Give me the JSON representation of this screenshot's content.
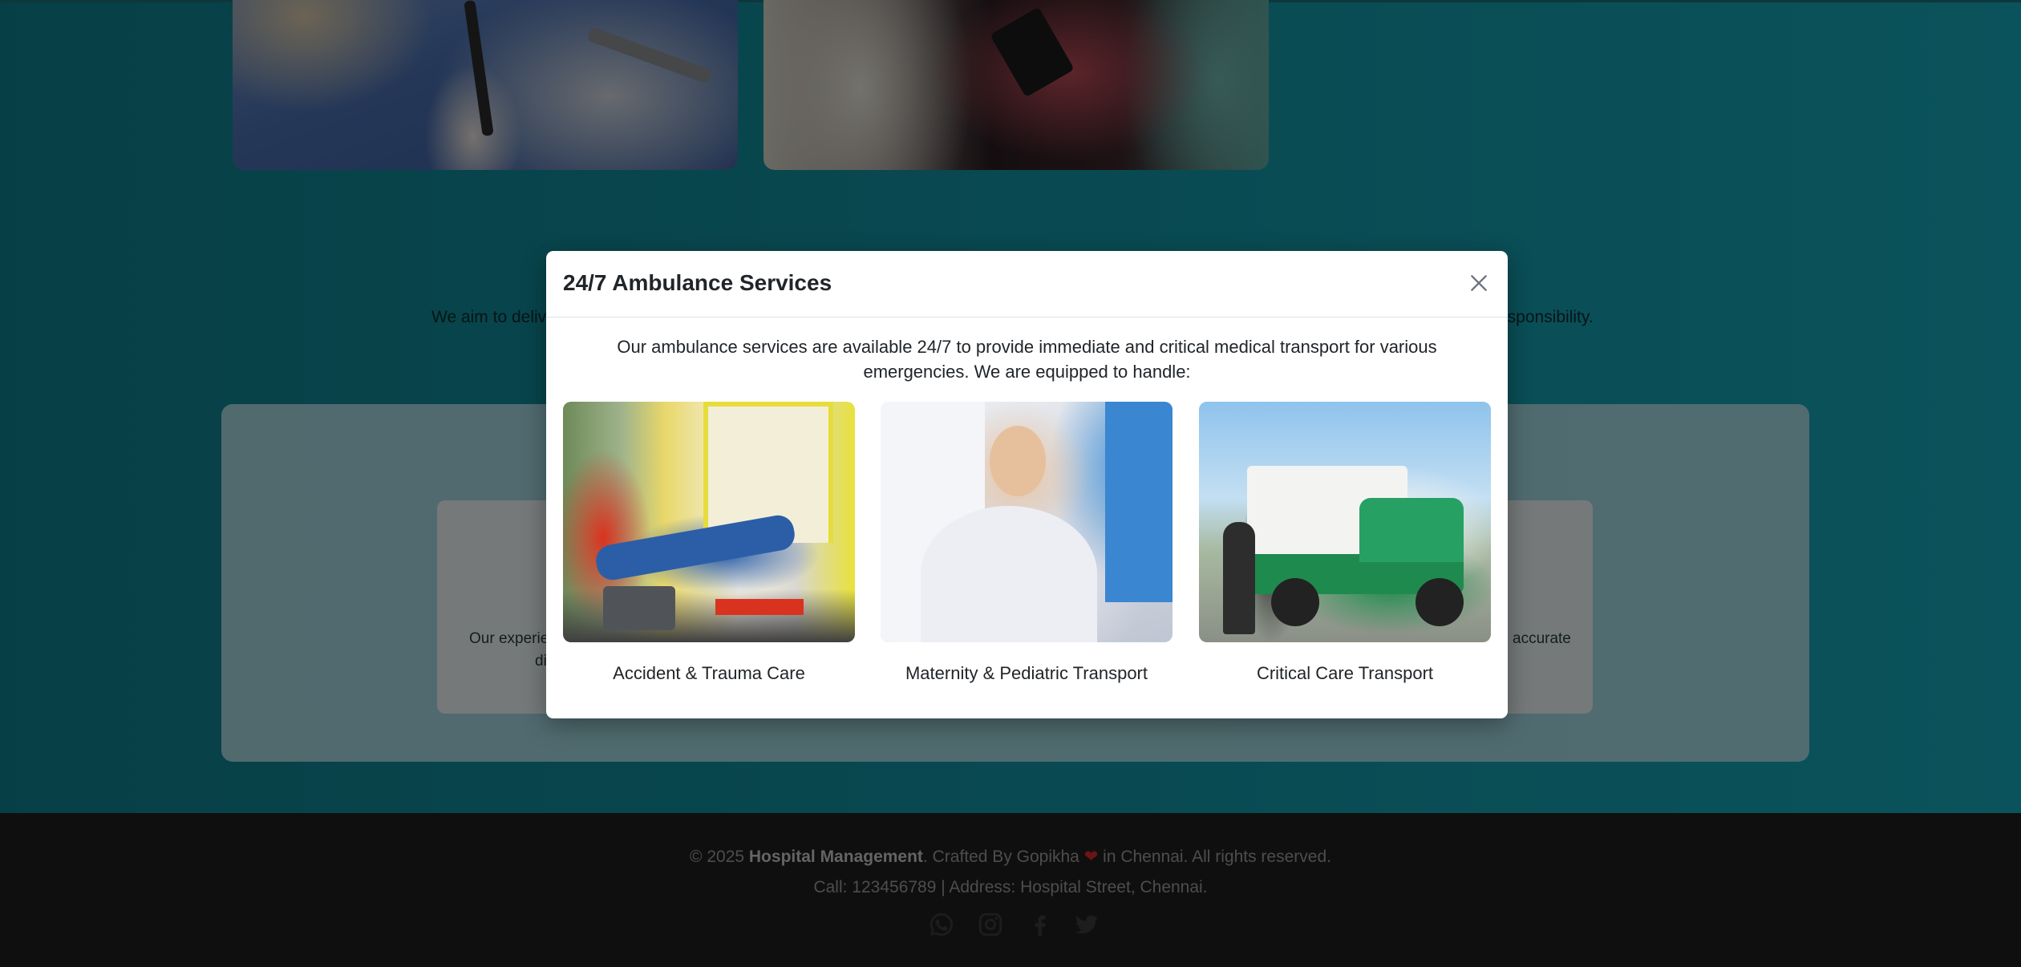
{
  "background": {
    "intro_left": "We aim to deliv",
    "intro_right": "esponsibility.",
    "card_left_line1": "Our experie",
    "card_left_line2": "di",
    "card_right_line1": "accurate"
  },
  "footer": {
    "year_prefix": "© 2025 ",
    "brand": "Hospital Management",
    "crafted": ". Crafted By Gopikha ",
    "heart": "❤",
    "suffix": " in Chennai. All rights reserved.",
    "contact": "Call: 123456789 | Address: Hospital Street, Chennai.",
    "social_icons": [
      "whatsapp-icon",
      "instagram-icon",
      "facebook-icon",
      "twitter-icon"
    ]
  },
  "modal": {
    "title": "24/7 Ambulance Services",
    "intro": "Our ambulance services are available 24/7 to provide immediate and critical medical transport for various emergencies. We are equipped to handle:",
    "services": [
      {
        "label": "Accident & Trauma Care"
      },
      {
        "label": "Maternity & Pediatric Transport"
      },
      {
        "label": "Critical Care Transport"
      }
    ]
  },
  "colors": {
    "accent": "#16a6b8",
    "footer_bg": "#1f1f1f",
    "heart": "#d62828"
  }
}
